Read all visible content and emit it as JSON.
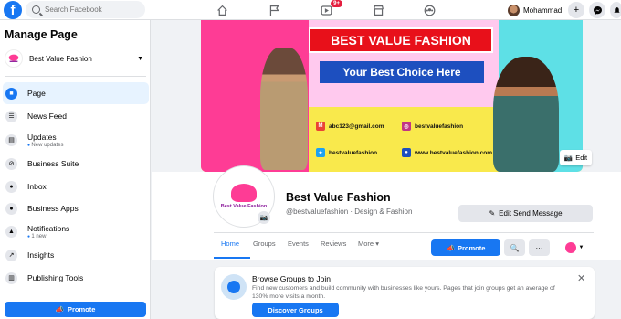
{
  "header": {
    "logo": "f",
    "search_placeholder": "Search Facebook",
    "nav": [
      "home-icon",
      "flag-icon",
      "video-icon",
      "marketplace-icon",
      "groups-icon"
    ],
    "video_badge": "9+",
    "user_name": "Mohammad",
    "plus": "+",
    "messenger": "m",
    "notifications": "🔔"
  },
  "sidebar": {
    "title": "Manage Page",
    "page_name": "Best Value Fashion",
    "items": [
      {
        "label": "Page",
        "sub": "",
        "icon": "page-icon"
      },
      {
        "label": "News Feed",
        "sub": "",
        "icon": "news-feed-icon"
      },
      {
        "label": "Updates",
        "sub": "New updates",
        "icon": "updates-icon"
      },
      {
        "label": "Business Suite",
        "sub": "",
        "icon": "business-suite-icon"
      },
      {
        "label": "Inbox",
        "sub": "",
        "icon": "inbox-icon"
      },
      {
        "label": "Business Apps",
        "sub": "",
        "icon": "business-apps-icon"
      },
      {
        "label": "Notifications",
        "sub": "1 new",
        "icon": "bell-icon"
      },
      {
        "label": "Insights",
        "sub": "",
        "icon": "insights-icon"
      },
      {
        "label": "Publishing Tools",
        "sub": "",
        "icon": "publishing-tools-icon"
      }
    ],
    "promote": "Promote"
  },
  "cover": {
    "headline": "BEST VALUE FASHION",
    "tagline": "Your Best Choice Here",
    "email": "abc123@gmail.com",
    "instagram": "bestvaluefashion",
    "twitter": "bestvaluefashion",
    "website": "www.bestvaluefashion.com",
    "edit": "Edit"
  },
  "profile": {
    "brand": "Best Value Fashion",
    "name": "Best Value Fashion",
    "subtitle": "@bestvaluefashion · Design & Fashion",
    "edit_send": "Edit Send Message"
  },
  "tabs": [
    "Home",
    "Groups",
    "Events",
    "Reviews",
    "More"
  ],
  "actions": {
    "promote": "Promote",
    "search": "🔍",
    "more": "···"
  },
  "groups_card": {
    "title": "Browse Groups to Join",
    "text": "Find new customers and build community with businesses like yours. Pages that join groups get an average of 130% more visits a month.",
    "button": "Discover Groups",
    "close": "✕"
  },
  "colors": {
    "brand": "#1877f2",
    "cover_pink": "#fe3c95",
    "cover_cyan": "#5ee0e6",
    "cover_yellow": "#f7e84a",
    "banner_red": "#e8101a",
    "banner_blue": "#1d4fbf"
  }
}
